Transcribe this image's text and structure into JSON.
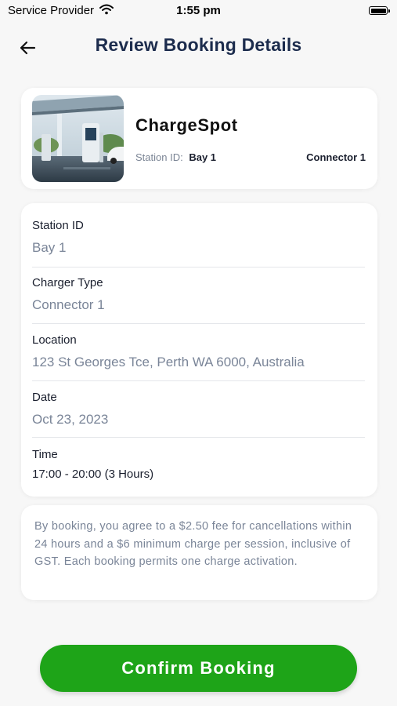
{
  "status_bar": {
    "carrier": "Service Provider",
    "time": "1:55 pm"
  },
  "header": {
    "title": "Review Booking Details",
    "back_icon": "arrow-left-icon"
  },
  "station": {
    "name": "ChargeSpot",
    "station_id_label": "Station ID:",
    "station_id_value": "Bay 1",
    "connector": "Connector 1"
  },
  "details": {
    "station_id": {
      "label": "Station ID",
      "value": "Bay 1"
    },
    "charger_type": {
      "label": "Charger Type",
      "value": "Connector 1"
    },
    "location": {
      "label": "Location",
      "value": "123 St Georges Tce, Perth WA 6000, Australia"
    },
    "date": {
      "label": "Date",
      "value": "Oct 23, 2023"
    },
    "time": {
      "label": "Time",
      "value": "17:00 - 20:00 (3 Hours)"
    }
  },
  "notice": {
    "text": "By booking, you agree to a $2.50 fee for cancellations within 24 hours and a $6 minimum charge per session, inclusive of GST. Each booking permits one charge activation."
  },
  "actions": {
    "confirm_label": "Confirm Booking"
  },
  "colors": {
    "accent": "#1ea418",
    "title": "#1c2c4d",
    "muted": "#7a8598",
    "background": "#f7f7f7"
  }
}
